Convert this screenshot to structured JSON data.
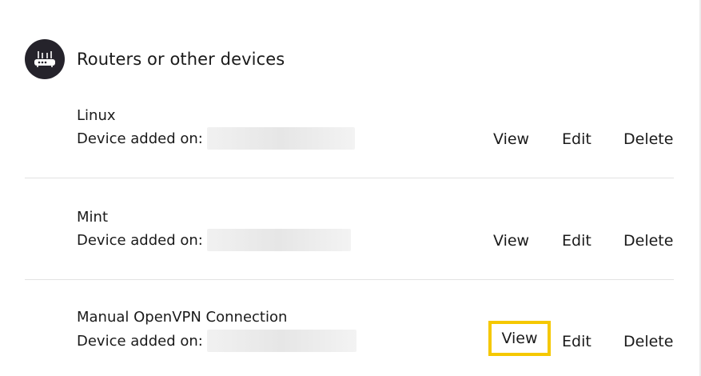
{
  "section": {
    "title": "Routers or other devices",
    "icon": "router-icon"
  },
  "devices": [
    {
      "name": "Linux",
      "added_label": "Device added on:",
      "actions": {
        "view": "View",
        "edit": "Edit",
        "delete": "Delete"
      }
    },
    {
      "name": "Mint",
      "added_label": "Device added on:",
      "actions": {
        "view": "View",
        "edit": "Edit",
        "delete": "Delete"
      }
    },
    {
      "name": "Manual OpenVPN Connection",
      "added_label": "Device added on:",
      "actions": {
        "view": "View",
        "edit": "Edit",
        "delete": "Delete"
      }
    }
  ],
  "colors": {
    "badge": "#25232b",
    "highlight": "#f5c800",
    "divider": "#e3e3e3",
    "text": "#1a1a1a"
  }
}
